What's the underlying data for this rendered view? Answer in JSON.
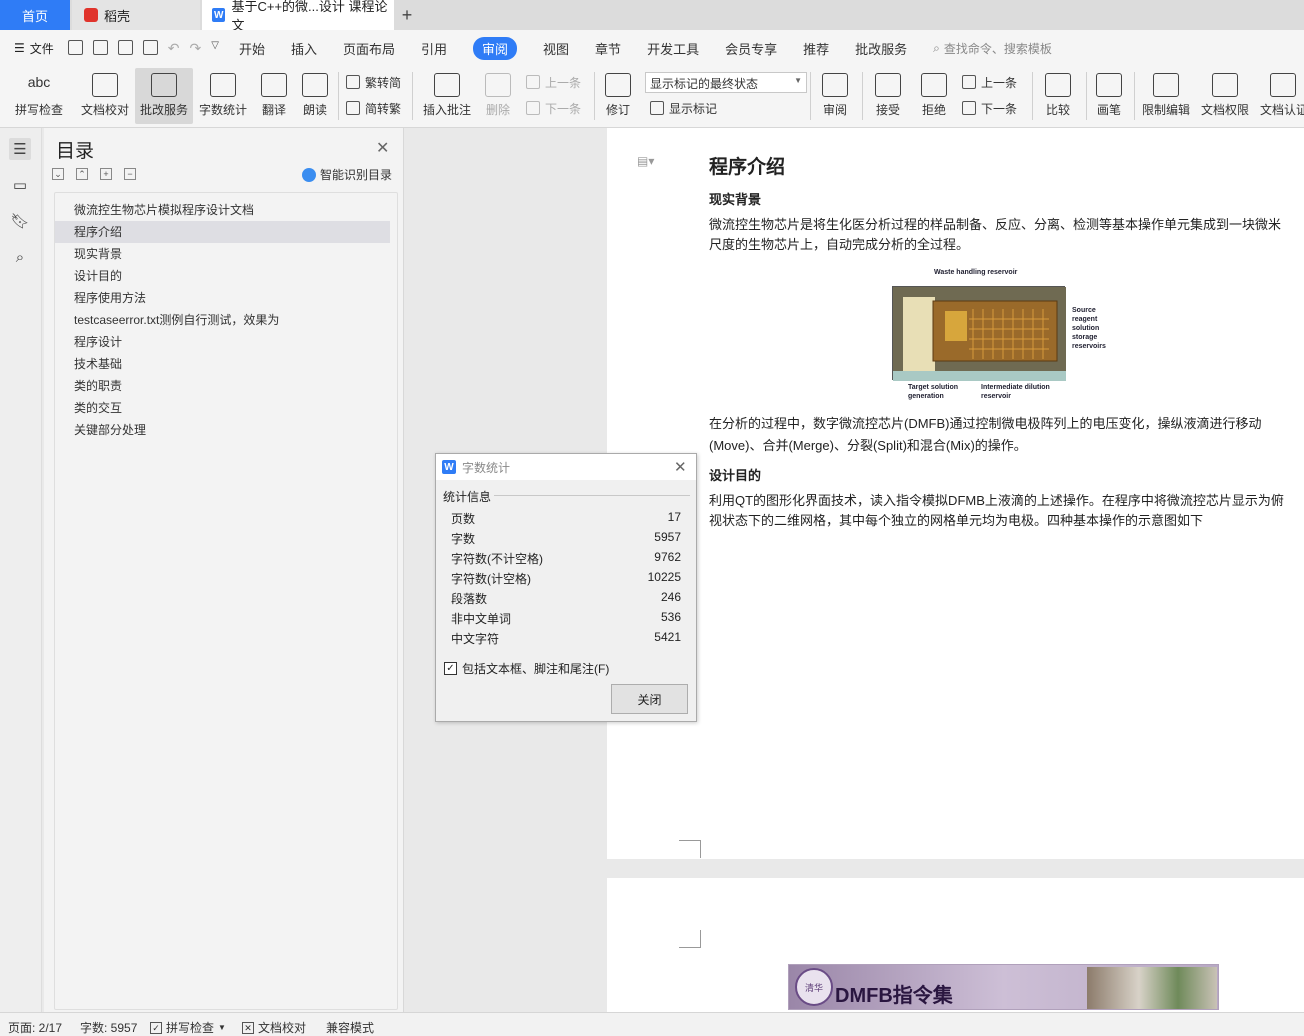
{
  "tabs": {
    "home": "首页",
    "daoke": "稻壳",
    "doc": "基于C++的微...设计 课程论文",
    "plus": "+"
  },
  "menu": {
    "file": "文件",
    "items": [
      "开始",
      "插入",
      "页面布局",
      "引用",
      "审阅",
      "视图",
      "章节",
      "开发工具",
      "会员专享",
      "推荐",
      "批改服务"
    ],
    "active": "审阅",
    "search": "查找命令、搜索模板"
  },
  "ribbon": {
    "spell": "拼写检查",
    "doc_check": "文档校对",
    "grading": "批改服务",
    "word_count": "字数统计",
    "translate": "翻译",
    "read_aloud": "朗读",
    "trad_to_simp": "繁转简",
    "simp_to_trad": "简转繁",
    "insert_comment": "插入批注",
    "delete": "删除",
    "prev": "上一条",
    "next": "下一条",
    "revise": "修订",
    "markup_state": "显示标记的最终状态",
    "show_markup": "显示标记",
    "review": "审阅",
    "accept": "接受",
    "reject": "拒绝",
    "prev2": "上一条",
    "next2": "下一条",
    "compare": "比较",
    "pen": "画笔",
    "restrict_edit": "限制编辑",
    "doc_rights": "文档权限",
    "doc_cert": "文档认证"
  },
  "toc": {
    "title": "目录",
    "smart": "智能识别目录",
    "items": [
      "微流控生物芯片模拟程序设计文档",
      "程序介绍",
      "现实背景",
      "设计目的",
      "程序使用方法",
      "testcaseerror.txt测例自行测试，效果为",
      "程序设计",
      "技术基础",
      "类的职责",
      "类的交互",
      "关键部分处理"
    ],
    "active_index": 1
  },
  "document": {
    "heading": "程序介绍",
    "sub1": "现实背景",
    "para1": "微流控生物芯片是将生化医分析过程的样品制备、反应、分离、检测等基本操作单元集成到一块微米尺度的生物芯片上，自动完成分析的全过程。",
    "figure_labels": {
      "waste": "Waste handling reservoir",
      "source": "Source reagent solution storage reservoirs",
      "target": "Target solution generation",
      "intermediate": "Intermediate dilution reservoir"
    },
    "para2": "在分析的过程中，数字微流控芯片(DMFB)通过控制微电极阵列上的电压变化，操纵液滴进行移动(Move)、合并(Merge)、分裂(Split)和混合(Mix)的操作。",
    "sub2": "设计目的",
    "para3": "利用QT的图形化界面技术，读入指令模拟DFMB上液滴的上述操作。在程序中将微流控芯片显示为俯视状态下的二维网格，其中每个独立的网格单元均为电极。四种基本操作的示意图如下",
    "banner_text": "DMFB指令集",
    "banner_seal": "清华"
  },
  "dialog": {
    "title": "字数统计",
    "group": "统计信息",
    "rows": [
      {
        "label": "页数",
        "value": "17"
      },
      {
        "label": "字数",
        "value": "5957"
      },
      {
        "label": "字符数(不计空格)",
        "value": "9762"
      },
      {
        "label": "字符数(计空格)",
        "value": "10225"
      },
      {
        "label": "段落数",
        "value": "246"
      },
      {
        "label": "非中文单词",
        "value": "536"
      },
      {
        "label": "中文字符",
        "value": "5421"
      }
    ],
    "include_label": "包括文本框、脚注和尾注(F)",
    "include_checked": true,
    "close_button": "关闭"
  },
  "status": {
    "page": "页面: 2/17",
    "words": "字数: 5957",
    "spell": "拼写检查",
    "doc_check": "文档校对",
    "compat": "兼容模式"
  },
  "colors": {
    "accent": "#2f7cf6",
    "doc_icon": "#2f7cf6",
    "daoke_icon": "#e0332b"
  }
}
